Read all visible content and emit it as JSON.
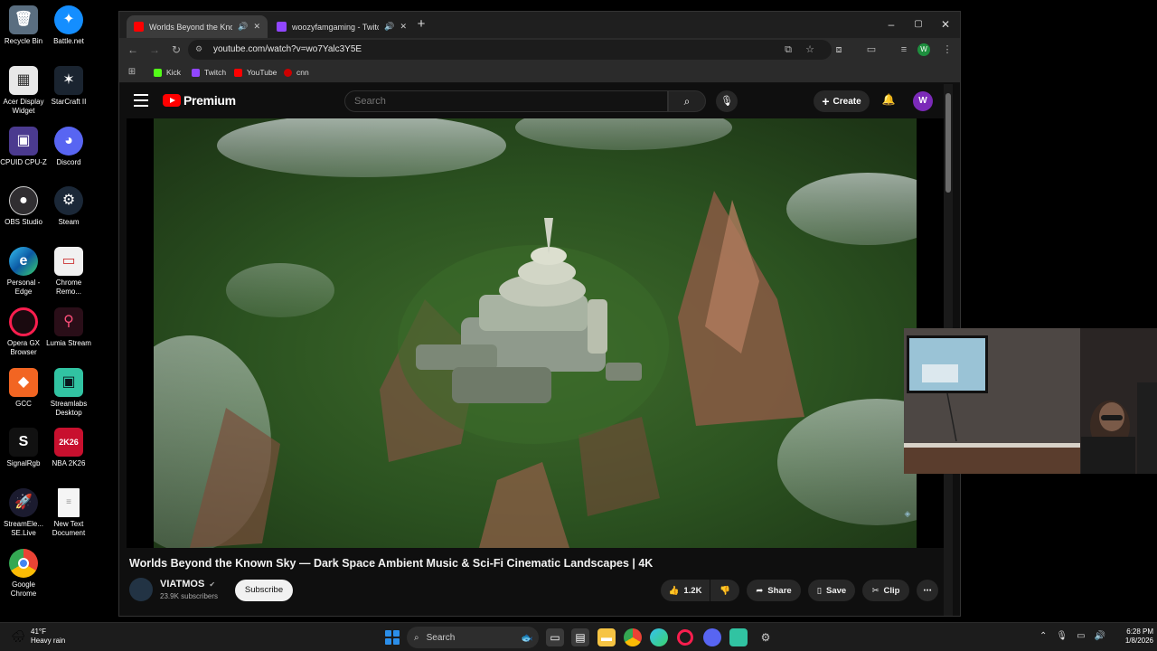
{
  "desktop": {
    "icons": [
      {
        "label": "Recycle Bin"
      },
      {
        "label": "Battle.net"
      },
      {
        "label": "Acer Display Widget"
      },
      {
        "label": "StarCraft II"
      },
      {
        "label": "CPUID CPU-Z"
      },
      {
        "label": "Discord"
      },
      {
        "label": "OBS Studio"
      },
      {
        "label": "Steam"
      },
      {
        "label": "Personal - Edge"
      },
      {
        "label": "Chrome Remo..."
      },
      {
        "label": "Opera GX Browser"
      },
      {
        "label": "Lumia Stream"
      },
      {
        "label": "GCC"
      },
      {
        "label": "Streamlabs Desktop"
      },
      {
        "label": "SignalRgb"
      },
      {
        "label": "NBA 2K26"
      },
      {
        "label": "StreamEle... SE.Live"
      },
      {
        "label": "New Text Document"
      },
      {
        "label": "Google Chrome"
      }
    ],
    "nba_badge": "2K26"
  },
  "browser": {
    "tabs": [
      {
        "title": "Worlds Beyond the Known"
      },
      {
        "title": "woozyfamgaming - Twitch"
      }
    ],
    "address": "youtube.com/watch?v=wo7Yalc3Y5E",
    "profile_initial": "W",
    "bookmarks": [
      {
        "label": "Kick"
      },
      {
        "label": "Twitch"
      },
      {
        "label": "YouTube"
      },
      {
        "label": "cnn"
      }
    ],
    "colors": {
      "kick": "#53fc18",
      "twitch": "#9146ff",
      "youtube": "#ff0000",
      "cnn": "#cc0000"
    }
  },
  "youtube": {
    "logo_text": "Premium",
    "search_placeholder": "Search",
    "create_label": "Create",
    "avatar_initial": "W",
    "video": {
      "title": "Worlds Beyond the Known Sky — Dark Space Ambient Music & Sci-Fi Cinematic Landscapes | 4K",
      "channel": "VIATMOS",
      "subscribers": "23.9K subscribers",
      "subscribe_label": "Subscribe",
      "likes": "1.2K",
      "share_label": "Share",
      "save_label": "Save",
      "clip_label": "Clip"
    }
  },
  "taskbar": {
    "weather_temp": "41°F",
    "weather_desc": "Heavy rain",
    "search_label": "Search",
    "time": "6:28 PM",
    "date": "1/8/2026"
  }
}
